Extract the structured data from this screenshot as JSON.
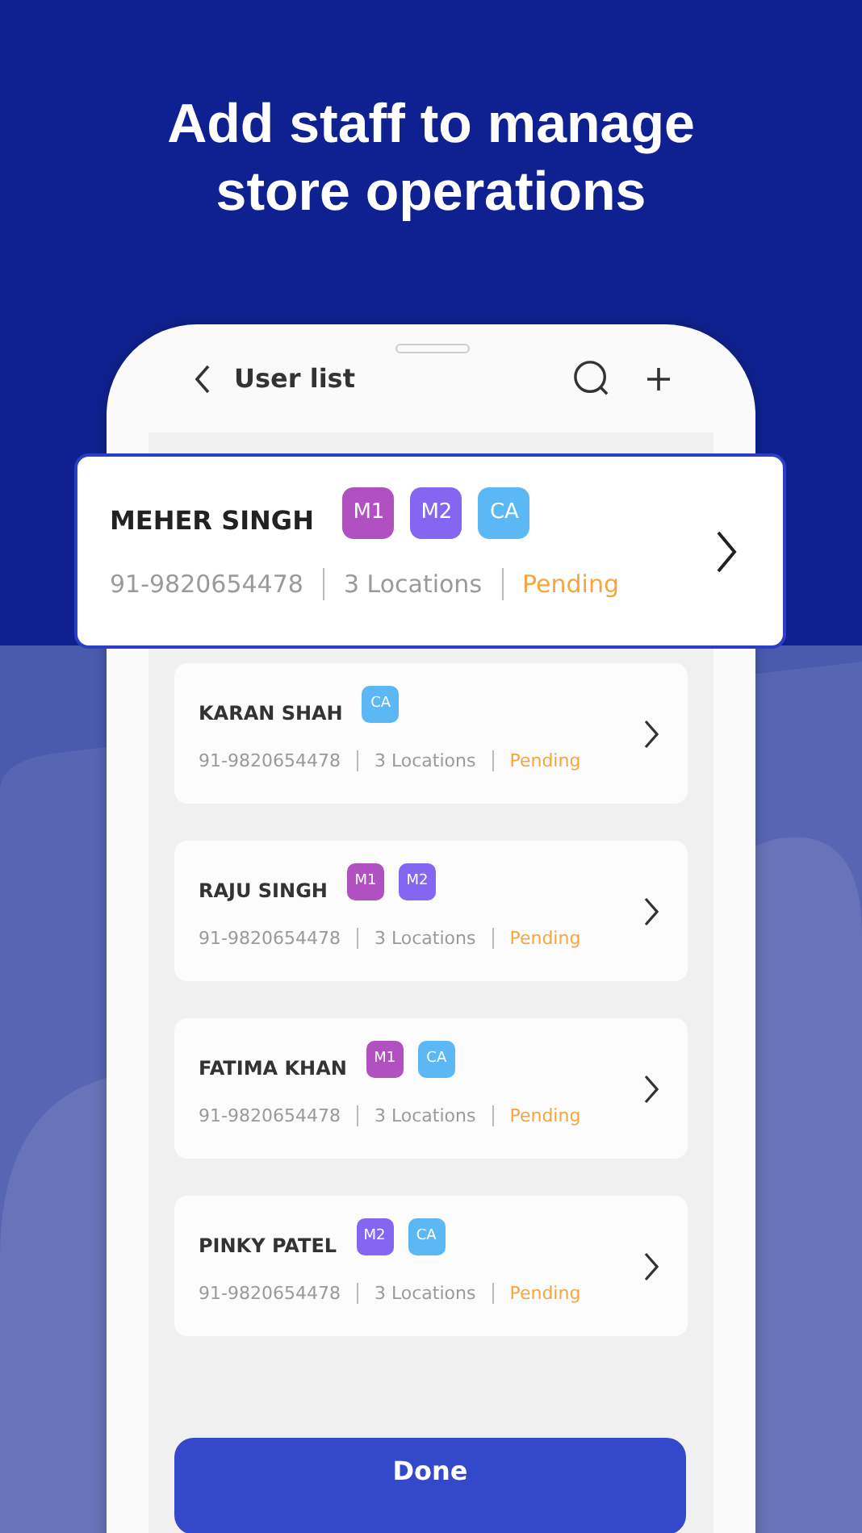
{
  "headline": "Add staff to manage store operations",
  "screen": {
    "title": "User list",
    "highlighted_user": {
      "name": "MEHER SINGH",
      "tags": [
        {
          "label": "M1",
          "color": "#b150c0"
        },
        {
          "label": "M2",
          "color": "#8466f0"
        },
        {
          "label": "CA",
          "color": "#5bb8f5"
        }
      ],
      "phone": "91-9820654478",
      "locations": "3 Locations",
      "status": "Pending"
    },
    "users": [
      {
        "name": "KARAN SHAH",
        "tags": [
          {
            "label": "CA",
            "color": "#5bb8f5"
          }
        ],
        "phone": "91-9820654478",
        "locations": "3 Locations",
        "status": "Pending"
      },
      {
        "name": "RAJU SINGH",
        "tags": [
          {
            "label": "M1",
            "color": "#b150c0"
          },
          {
            "label": "M2",
            "color": "#8466f0"
          }
        ],
        "phone": "91-9820654478",
        "locations": "3 Locations",
        "status": "Pending"
      },
      {
        "name": "FATIMA KHAN",
        "tags": [
          {
            "label": "M1",
            "color": "#b150c0"
          },
          {
            "label": "CA",
            "color": "#5bb8f5"
          }
        ],
        "phone": "91-9820654478",
        "locations": "3 Locations",
        "status": "Pending"
      },
      {
        "name": "PINKY PATEL",
        "tags": [
          {
            "label": "M2",
            "color": "#8466f0"
          },
          {
            "label": "CA",
            "color": "#5bb8f5"
          }
        ],
        "phone": "91-9820654478",
        "locations": "3 Locations",
        "status": "Pending"
      }
    ],
    "done_button": "Done"
  }
}
